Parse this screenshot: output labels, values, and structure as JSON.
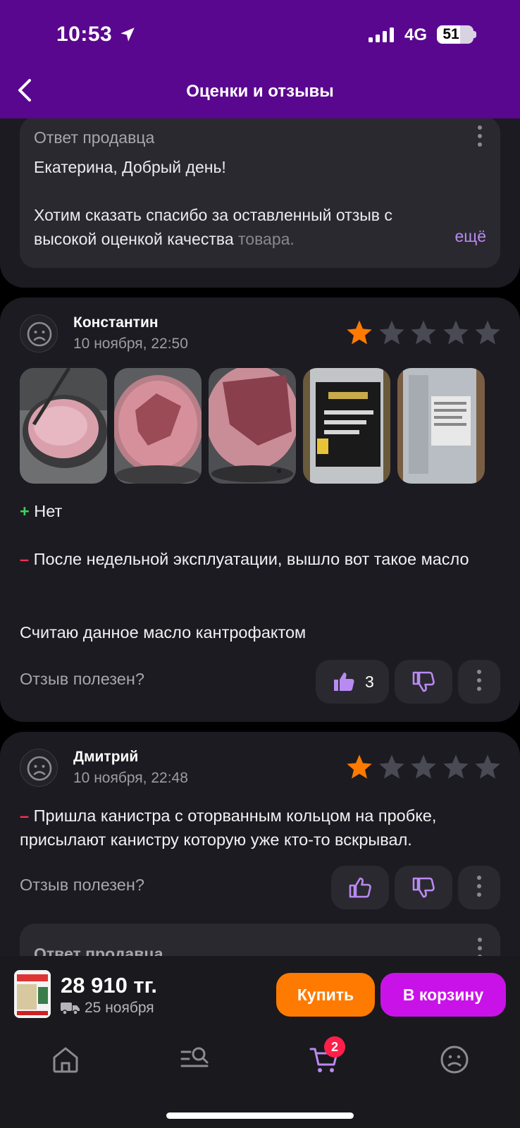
{
  "status_bar": {
    "time": "10:53",
    "network": "4G",
    "battery": "51"
  },
  "header": {
    "title": "Оценки и отзывы"
  },
  "seller_reply_1": {
    "title": "Ответ продавца",
    "greeting": "Екатерина, Добрый день!",
    "text": "Хотим сказать спасибо за оставленный отзыв с высокой оценкой качества ",
    "text_faded": "товара.",
    "more": "ещё"
  },
  "review_1": {
    "author": "Константин",
    "date": "10 ноября, 22:50",
    "rating": 1,
    "max_rating": 5,
    "pros_sign": "+",
    "pros": "Нет",
    "cons_sign": "–",
    "cons": "После недельной эксплуатации, вышло вот такое масло",
    "comment": "Считаю данное масло кантрофактом",
    "helpful_label": "Отзыв полезен?",
    "likes": "3"
  },
  "review_2": {
    "author": "Дмитрий",
    "date": "10 ноября, 22:48",
    "rating": 1,
    "max_rating": 5,
    "cons_sign": "–",
    "cons": "Пришла канистра с оторванным кольцом на пробке, присылают канистру которую уже кто-то вскрывал.",
    "helpful_label": "Отзыв полезен?",
    "reply_title": "Ответ продавца"
  },
  "buy_bar": {
    "price": "28 910 тг.",
    "delivery": "25 ноября",
    "buy_label": "Купить",
    "cart_label": "В корзину"
  },
  "tabbar": {
    "cart_badge": "2"
  },
  "colors": {
    "accent": "#5a078f",
    "star_active": "#ff7a00",
    "star_inactive": "#4a4a55",
    "buy": "#ff7a00",
    "cart": "#c912e8"
  }
}
